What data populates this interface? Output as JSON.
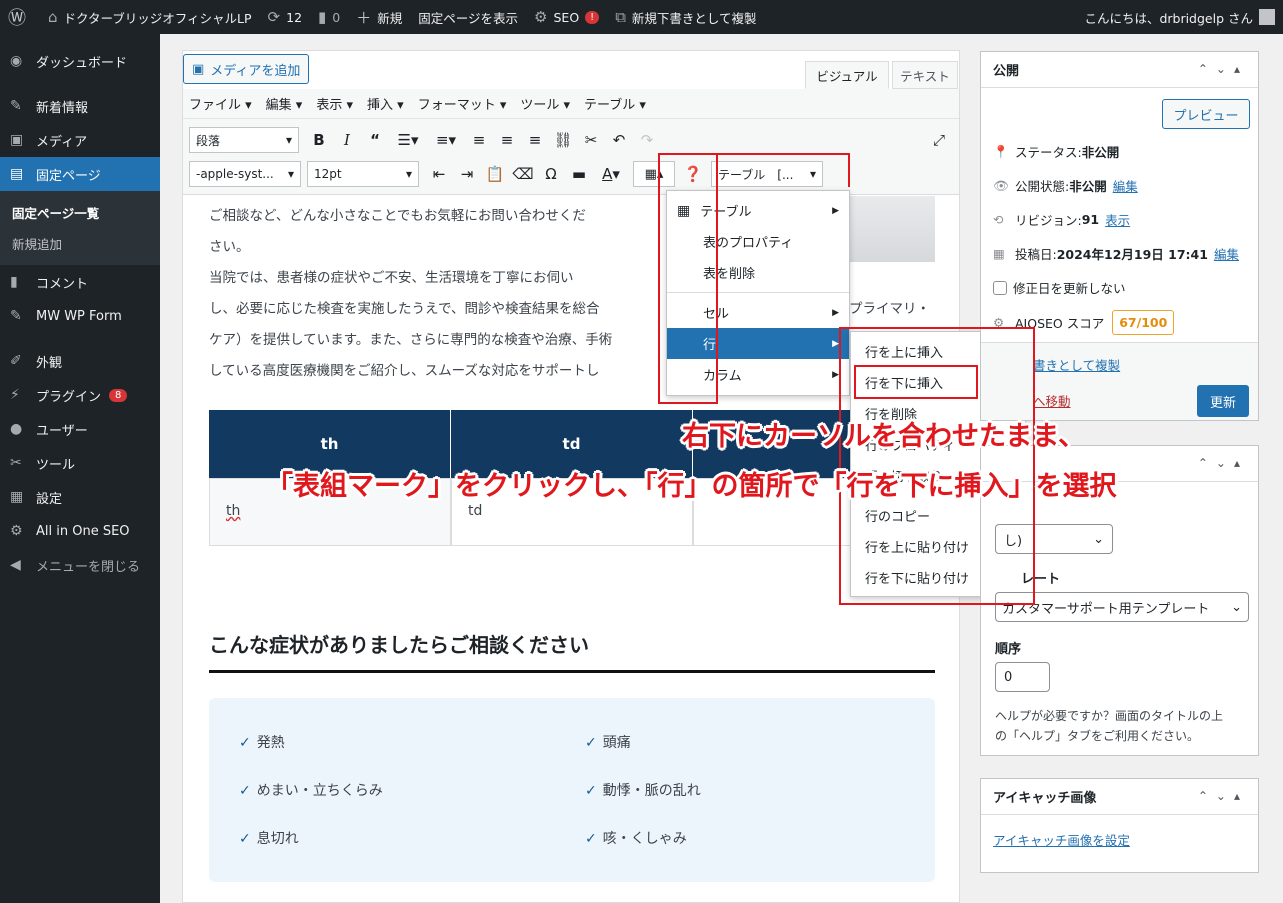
{
  "adminbar": {
    "site_name": "ドクターブリッジオフィシャルLP",
    "updates": "12",
    "comments": "0",
    "new": "新規",
    "view_page": "固定ページを表示",
    "seo": "SEO",
    "seo_badge": "!",
    "duplicate": "新規下書きとして複製",
    "greeting": "こんにちは、drbridgelp さん"
  },
  "sidebar": {
    "items": [
      {
        "icon": "dashboard-icon",
        "label": "ダッシュボード"
      },
      {
        "icon": "pin-icon",
        "label": "新着情報"
      },
      {
        "icon": "media-icon",
        "label": "メディア"
      },
      {
        "icon": "page-icon",
        "label": "固定ページ"
      },
      {
        "icon": "comment-icon",
        "label": "コメント"
      },
      {
        "icon": "pin-icon",
        "label": "MW WP Form"
      },
      {
        "icon": "brush-icon",
        "label": "外観"
      },
      {
        "icon": "plugin-icon",
        "label": "プラグイン",
        "badge": "8"
      },
      {
        "icon": "user-icon",
        "label": "ユーザー"
      },
      {
        "icon": "wrench-icon",
        "label": "ツール"
      },
      {
        "icon": "settings-icon",
        "label": "設定"
      },
      {
        "icon": "aioseo-icon",
        "label": "All in One SEO"
      },
      {
        "icon": "collapse-icon",
        "label": "メニューを閉じる"
      }
    ],
    "submenu": [
      "固定ページ一覧",
      "新規追加"
    ]
  },
  "editor": {
    "add_media": "メディアを追加",
    "tab_visual": "ビジュアル",
    "tab_text": "テキスト",
    "menubar": [
      "ファイル ▾",
      "編集 ▾",
      "表示 ▾",
      "挿入 ▾",
      "フォーマット ▾",
      "ツール ▾",
      "テーブル ▾"
    ],
    "format_select": "段落",
    "font_select": "-apple-syst...",
    "size_select": "12pt",
    "table_select": "テーブル　[...",
    "paragraphs": [
      "ご相談など、どんな小さなことでもお気軽にお問い合わせくだ",
      "さい。",
      "当院では、患者様の症状やご不安、生活環境を丁寧にお伺い",
      "し、必要に応じた検査を実施したうえで、問診や検査結果を総合",
      "ケア）を提供しています。また、さらに専門的な検査や治療、手術",
      "している高度医療機関をご紹介し、スムーズな対応をサポートし"
    ],
    "para_tail": "プライマリ・",
    "table": {
      "headers": [
        "th",
        "td"
      ],
      "cells": [
        "th",
        "td"
      ]
    },
    "heading": "こんな症状がありましたらご相談ください",
    "symptoms": [
      "発熱",
      "頭痛",
      "めまい・立ちくらみ",
      "動悸・脈の乱れ",
      "息切れ",
      "咳・くしゃみ"
    ]
  },
  "table_menu": {
    "items": [
      "テーブル",
      "表のプロパティ",
      "表を削除",
      "セル",
      "行",
      "カラム"
    ],
    "row_submenu": [
      "行を上に挿入",
      "行を下に挿入",
      "行を削除",
      "行のプロパティ",
      "行の切り取り",
      "行のコピー",
      "行を上に貼り付け",
      "行を下に貼り付け"
    ]
  },
  "publish": {
    "title": "公開",
    "preview": "プレビュー",
    "status_label": "ステータス: ",
    "status_value": "非公開",
    "visibility_label": "公開状態: ",
    "visibility_value": "非公開",
    "edit": "編集",
    "revisions_label": "リビジョン: ",
    "revisions_value": "91",
    "revisions_link": "表示",
    "date_label": "投稿日: ",
    "date_value": "2024年12月19日 17:41",
    "date_edit": "編集",
    "no_update_date": "修正日を更新しない",
    "aioseo_label": "AIOSEO スコア",
    "aioseo_score": "67/100",
    "duplicate_link": "書きとして複製",
    "trash_link": "へ移動",
    "update": "更新"
  },
  "page_attributes": {
    "parent_select": "し)",
    "template_label": "レート",
    "template_select": "カスタマーサポート用テンプレート",
    "order_label": "順序",
    "order_value": "0",
    "help": [
      "ヘルプが必要ですか？画面のタイトルの上",
      "の「ヘルプ」タブをご利用ください。"
    ]
  },
  "featured_image": {
    "title": "アイキャッチ画像",
    "link": "アイキャッチ画像を設定"
  },
  "annotation": {
    "line1": "右下にカーソルを合わせたまま、",
    "line2": "「表組マーク」をクリックし、「行」の箇所で「行を下に挿入」を選択"
  },
  "colors": {
    "accent": "#2271b1",
    "annotation_red": "#e0171d",
    "table_header": "#12395f"
  }
}
